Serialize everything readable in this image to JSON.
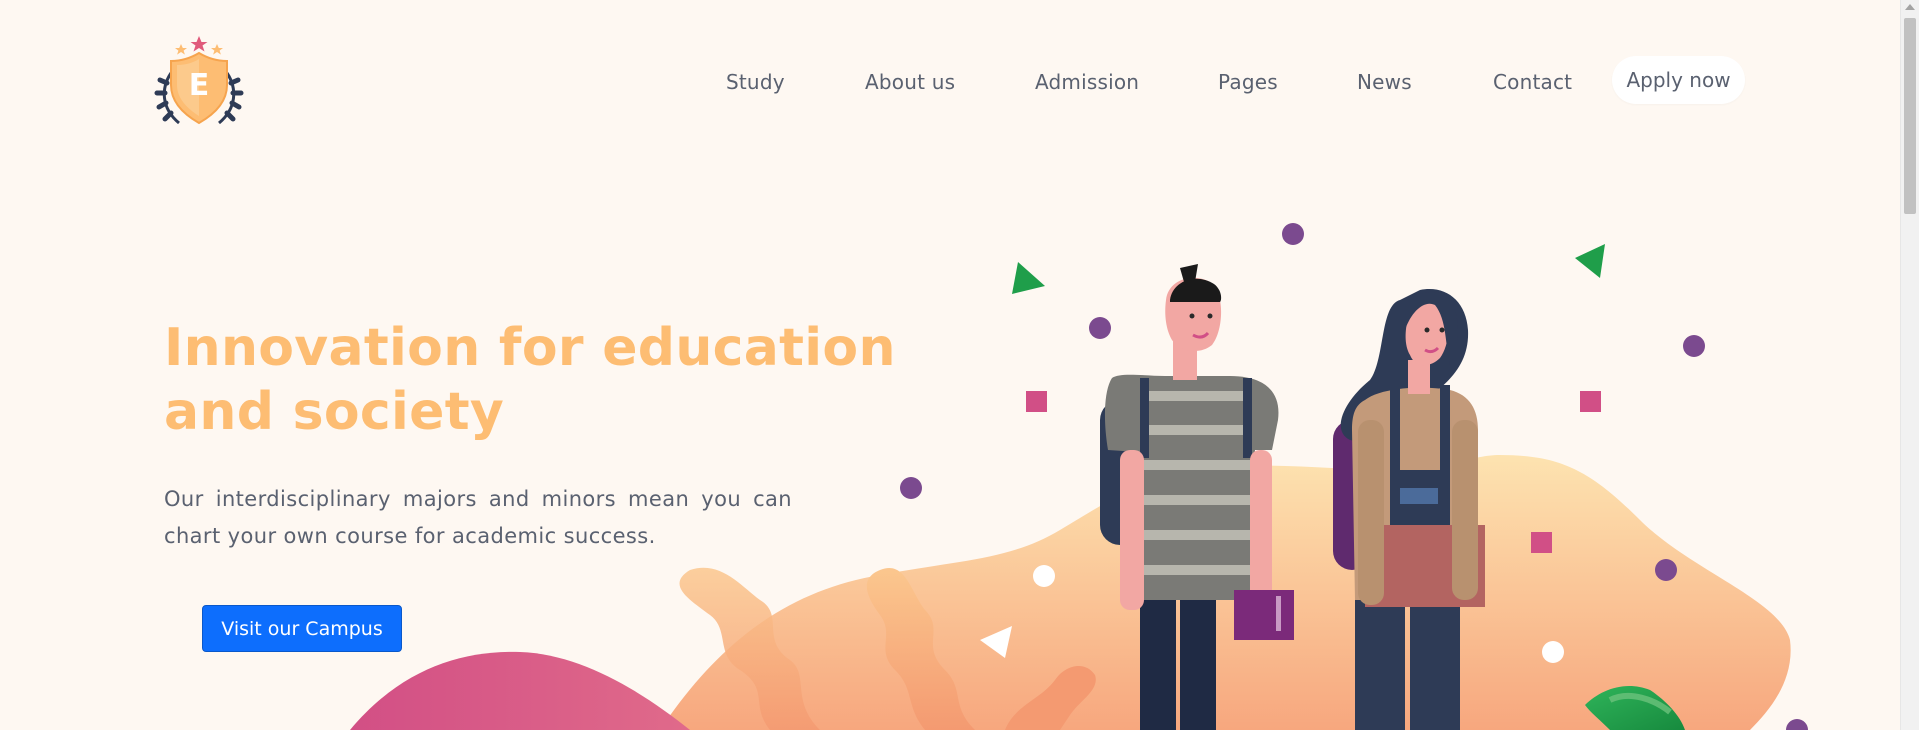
{
  "brand": {
    "logo_letter": "E"
  },
  "nav": {
    "items": [
      {
        "label": "Study"
      },
      {
        "label": "About us"
      },
      {
        "label": "Admission"
      },
      {
        "label": "Pages"
      },
      {
        "label": "News"
      },
      {
        "label": "Contact"
      }
    ],
    "apply_label": "Apply now"
  },
  "hero": {
    "title_line1": "Innovation for education",
    "title_line2": "and society",
    "description": "Our interdisciplinary majors and minors mean you can chart your own course for academic success.",
    "cta_label": "Visit our Campus"
  },
  "colors": {
    "background": "#fef8f2",
    "title": "#fdbd73",
    "body_text": "#5a6170",
    "cta": "#0d6efd",
    "accent_purple": "#7b4a8f",
    "accent_pink": "#d14f86",
    "accent_green": "#1f9e4a"
  }
}
